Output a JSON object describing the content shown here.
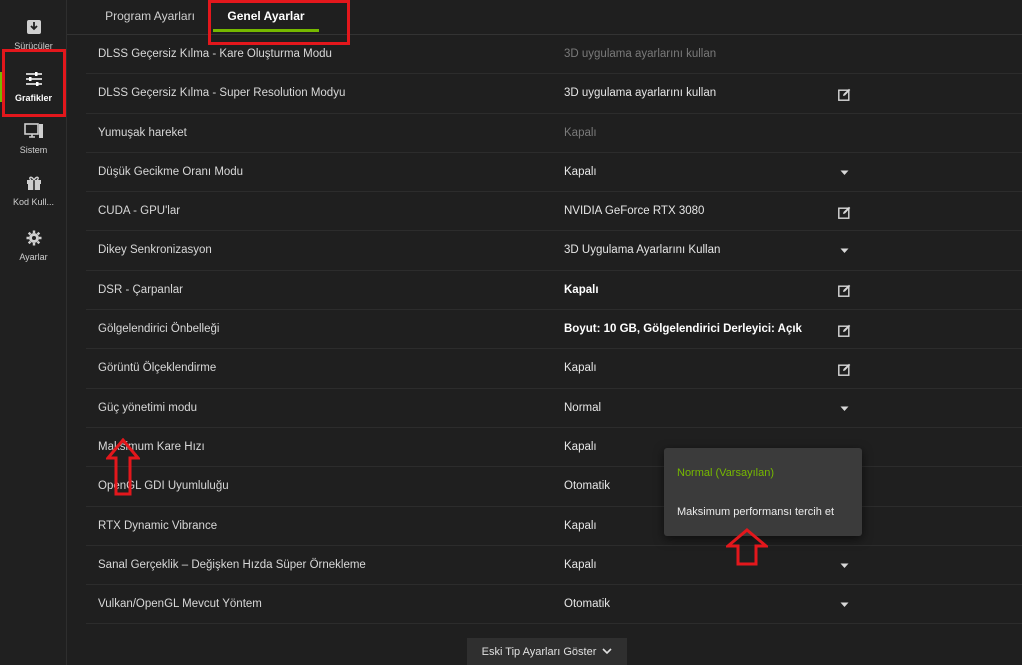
{
  "sidebar": {
    "items": [
      {
        "label": "Sürücüler",
        "icon": "download-icon"
      },
      {
        "label": "Grafikler",
        "icon": "sliders-icon"
      },
      {
        "label": "Sistem",
        "icon": "monitor-icon"
      },
      {
        "label": "Kod Kull...",
        "icon": "gift-icon"
      },
      {
        "label": "Ayarlar",
        "icon": "gear-icon"
      }
    ]
  },
  "tabs": [
    {
      "label": "Program Ayarları"
    },
    {
      "label": "Genel Ayarlar"
    }
  ],
  "settings": [
    {
      "name": "DLSS Geçersiz Kılma - Kare Oluşturma Modu",
      "value": "3D uygulama ayarlarını kullan",
      "style": "dim",
      "control": "none"
    },
    {
      "name": "DLSS Geçersiz Kılma - Super Resolution Modyu",
      "value": "3D uygulama ayarlarını kullan",
      "style": "normal",
      "control": "edit-icon"
    },
    {
      "name": "Yumuşak hareket",
      "value": "Kapalı",
      "style": "dim",
      "control": "none"
    },
    {
      "name": "Düşük Gecikme Oranı Modu",
      "value": "Kapalı",
      "style": "normal",
      "control": "chevron-down-icon"
    },
    {
      "name": "CUDA - GPU'lar",
      "value": "NVIDIA GeForce RTX 3080",
      "style": "normal",
      "control": "edit-icon"
    },
    {
      "name": "Dikey Senkronizasyon",
      "value": "3D Uygulama Ayarlarını Kullan",
      "style": "normal",
      "control": "chevron-down-icon"
    },
    {
      "name": "DSR - Çarpanlar",
      "value": "Kapalı",
      "style": "bold",
      "control": "edit-icon"
    },
    {
      "name": "Gölgelendirici Önbelleği",
      "value": "Boyut: 10 GB, Gölgelendirici Derleyici: Açık",
      "style": "bold",
      "control": "edit-icon"
    },
    {
      "name": "Görüntü Ölçeklendirme",
      "value": "Kapalı",
      "style": "normal",
      "control": "edit-icon"
    },
    {
      "name": "Güç yönetimi modu",
      "value": "Normal",
      "style": "normal",
      "control": "chevron-down-icon"
    },
    {
      "name": "Maksimum Kare Hızı",
      "value": "Kapalı",
      "style": "normal",
      "control": "none"
    },
    {
      "name": "OpenGL GDI Uyumluluğu",
      "value": "Otomatik",
      "style": "normal",
      "control": "none"
    },
    {
      "name": "RTX Dynamic Vibrance",
      "value": "Kapalı",
      "style": "normal",
      "control": "chevron-down-icon"
    },
    {
      "name": "Sanal Gerçeklik – Değişken Hızda Süper Örnekleme",
      "value": "Kapalı",
      "style": "normal",
      "control": "chevron-down-icon"
    },
    {
      "name": "Vulkan/OpenGL Mevcut Yöntem",
      "value": "Otomatik",
      "style": "normal",
      "control": "chevron-down-icon"
    }
  ],
  "dropdown": {
    "options": [
      "Normal (Varsayılan)",
      "Maksimum performansı tercih et"
    ],
    "selected_index": 0
  },
  "legacy_button": {
    "label": "Eski Tip Ayarları Göster"
  },
  "colors": {
    "accent": "#76b900",
    "highlight": "#e3171c"
  }
}
